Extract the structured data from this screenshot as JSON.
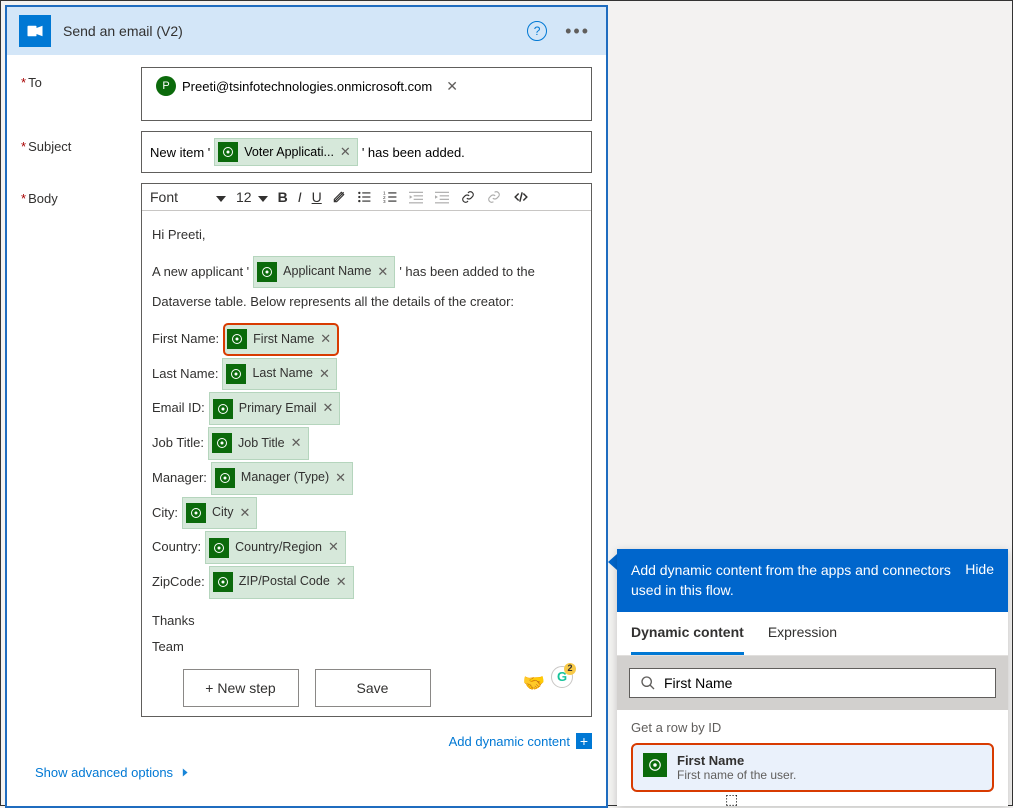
{
  "card": {
    "title": "Send an email (V2)",
    "to_label": "To",
    "subject_label": "Subject",
    "body_label": "Body",
    "to_recipient": "Preeti@tsinfotechnologies.onmicrosoft.com",
    "to_avatar": "P",
    "subject_prefix": "New item '",
    "subject_token": "Voter Applicati...",
    "subject_suffix": "' has been added.",
    "font_label": "Font",
    "font_size": "12",
    "body_greeting": "Hi Preeti,",
    "body_line1a": "A new applicant '",
    "body_token_applicant": "Applicant Name",
    "body_line1b": "' has been added to the",
    "body_line2": "Dataverse table. Below represents all the details of the creator:",
    "fields": [
      {
        "label": "First Name:",
        "token": "First Name",
        "highlight": true
      },
      {
        "label": "Last Name:",
        "token": "Last Name"
      },
      {
        "label": "Email ID:",
        "token": "Primary Email"
      },
      {
        "label": "Job Title:",
        "token": "Job Title"
      },
      {
        "label": "Manager:",
        "token": "Manager (Type)"
      },
      {
        "label": "City:",
        "token": "City"
      },
      {
        "label": "Country:",
        "token": "Country/Region"
      },
      {
        "label": "ZipCode:",
        "token": "ZIP/Postal Code"
      }
    ],
    "body_thanks": "Thanks",
    "body_team": "Team",
    "add_dynamic": "Add dynamic content",
    "advanced": "Show advanced options"
  },
  "buttons": {
    "new_step": "+ New step",
    "save": "Save"
  },
  "dyn": {
    "header": "Add dynamic content from the apps and connectors used in this flow.",
    "hide": "Hide",
    "tab1": "Dynamic content",
    "tab2": "Expression",
    "search_value": "First Name",
    "section": "Get a row by ID",
    "item_title": "First Name",
    "item_desc": "First name of the user."
  }
}
